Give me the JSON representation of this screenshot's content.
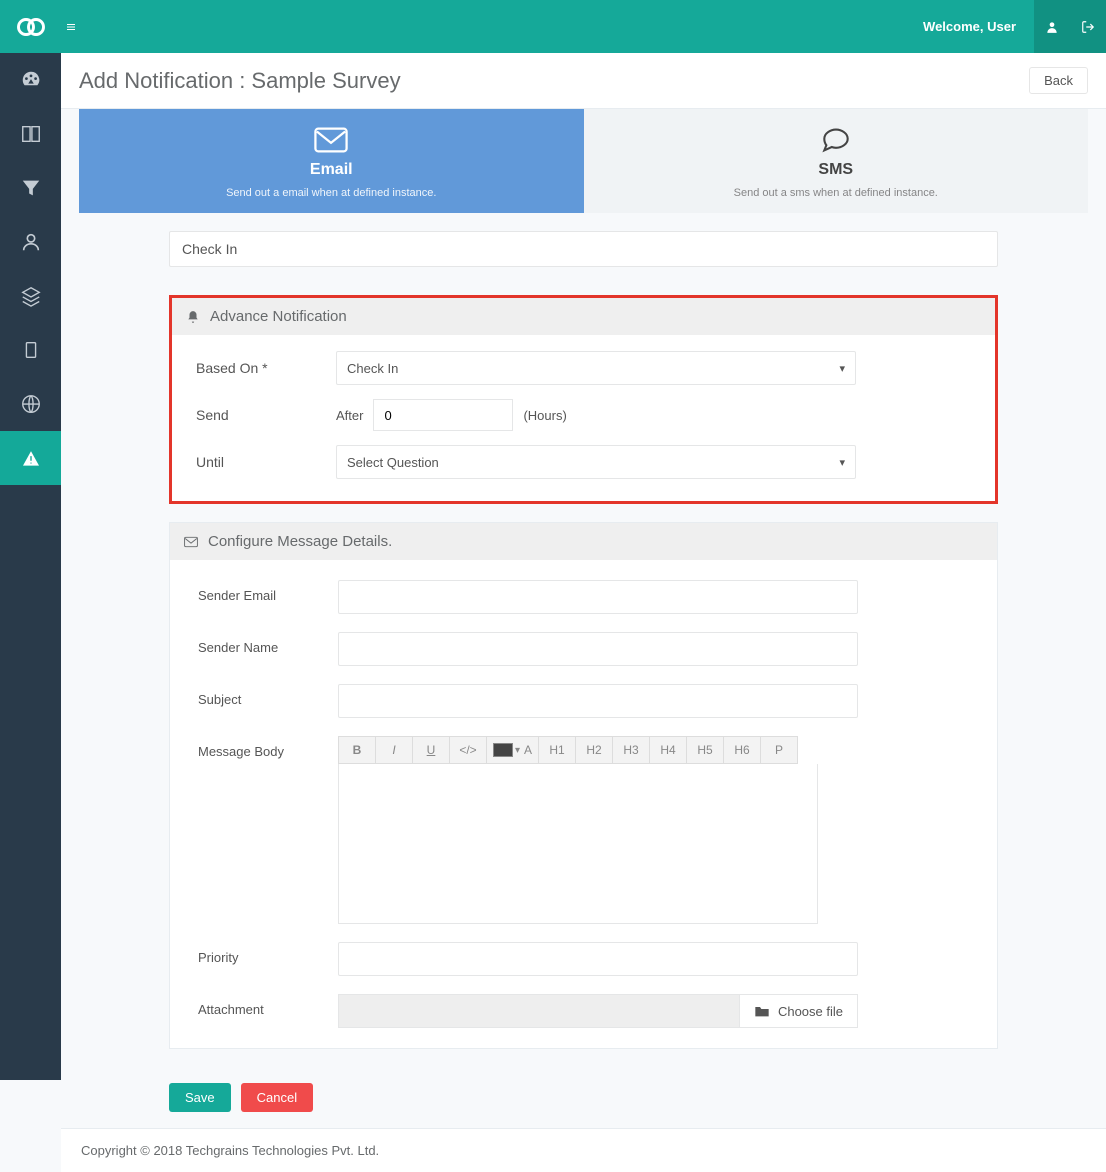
{
  "header": {
    "welcome": "Welcome, User"
  },
  "page": {
    "title": "Add Notification : Sample Survey",
    "back": "Back"
  },
  "tabs": {
    "email": {
      "title": "Email",
      "sub": "Send out a email when at defined instance."
    },
    "sms": {
      "title": "SMS",
      "sub": "Send out a sms when at defined instance."
    }
  },
  "form": {
    "name_value": "Check In",
    "advance_header": "Advance Notification",
    "based_on_label": "Based On *",
    "based_on_value": "Check In",
    "send_label": "Send",
    "send_prefix": "After",
    "send_value": "0",
    "send_suffix": "(Hours)",
    "until_label": "Until",
    "until_value": "Select Question",
    "config_header": "Configure Message Details.",
    "sender_email": "Sender Email",
    "sender_name": "Sender Name",
    "subject": "Subject",
    "message_body": "Message Body",
    "priority": "Priority",
    "attachment": "Attachment",
    "choose_file": "Choose file"
  },
  "toolbar": {
    "b": "B",
    "i": "I",
    "u": "U",
    "code": "</>",
    "h1": "H1",
    "h2": "H2",
    "h3": "H3",
    "h4": "H4",
    "h5": "H5",
    "h6": "H6",
    "p": "P",
    "ta": "A"
  },
  "actions": {
    "save": "Save",
    "cancel": "Cancel"
  },
  "footer": "Copyright © 2018 Techgrains Technologies Pvt. Ltd."
}
